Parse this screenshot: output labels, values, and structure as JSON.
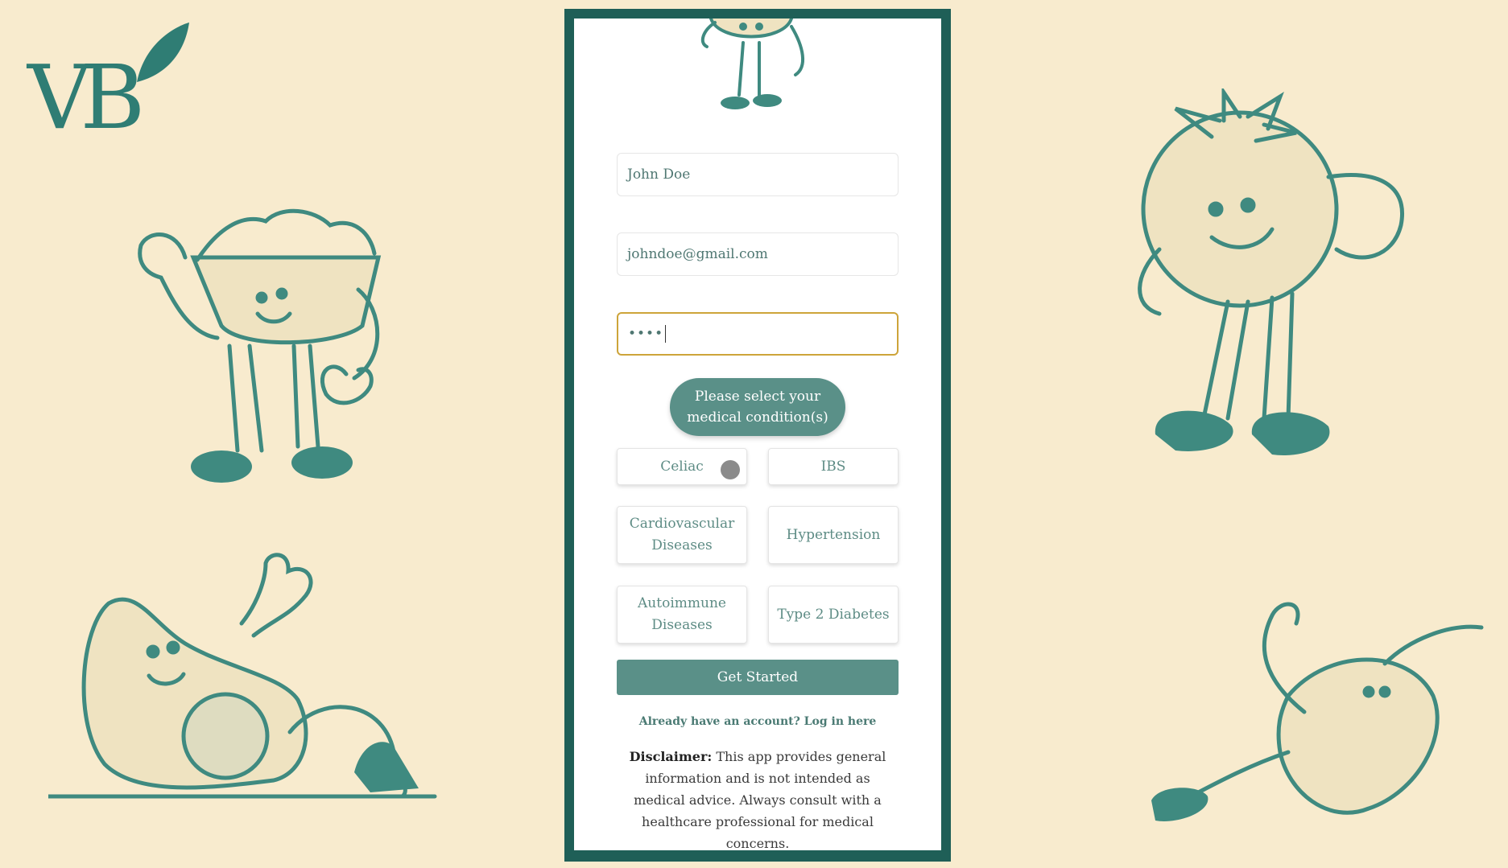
{
  "brand": {
    "logo_text": "VB"
  },
  "form": {
    "name": {
      "value": "John Doe"
    },
    "email": {
      "value": "johndoe@gmail.com"
    },
    "password": {
      "masked_value": "••••"
    },
    "conditions_prompt_line1": "Please select your",
    "conditions_prompt_line2": "medical condition(s)",
    "conditions": [
      {
        "line1": "Celiac",
        "line2": ""
      },
      {
        "line1": "IBS",
        "line2": ""
      },
      {
        "line1": "Cardiovascular",
        "line2": "Diseases"
      },
      {
        "line1": "Hypertension",
        "line2": ""
      },
      {
        "line1": "Autoimmune",
        "line2": "Diseases"
      },
      {
        "line1": "Type 2 Diabetes",
        "line2": ""
      }
    ],
    "submit_label": "Get Started",
    "login_link": "Already have an account? Log in here"
  },
  "disclaimer": {
    "label": "Disclaimer:",
    "text": " This app provides general information and is not intended as medical advice. Always consult with a healthcare professional for medical concerns."
  },
  "colors": {
    "background": "#f8ebce",
    "brand_teal": "#1f5f57",
    "accent": "#5a9088",
    "focus_border": "#cda43a"
  }
}
